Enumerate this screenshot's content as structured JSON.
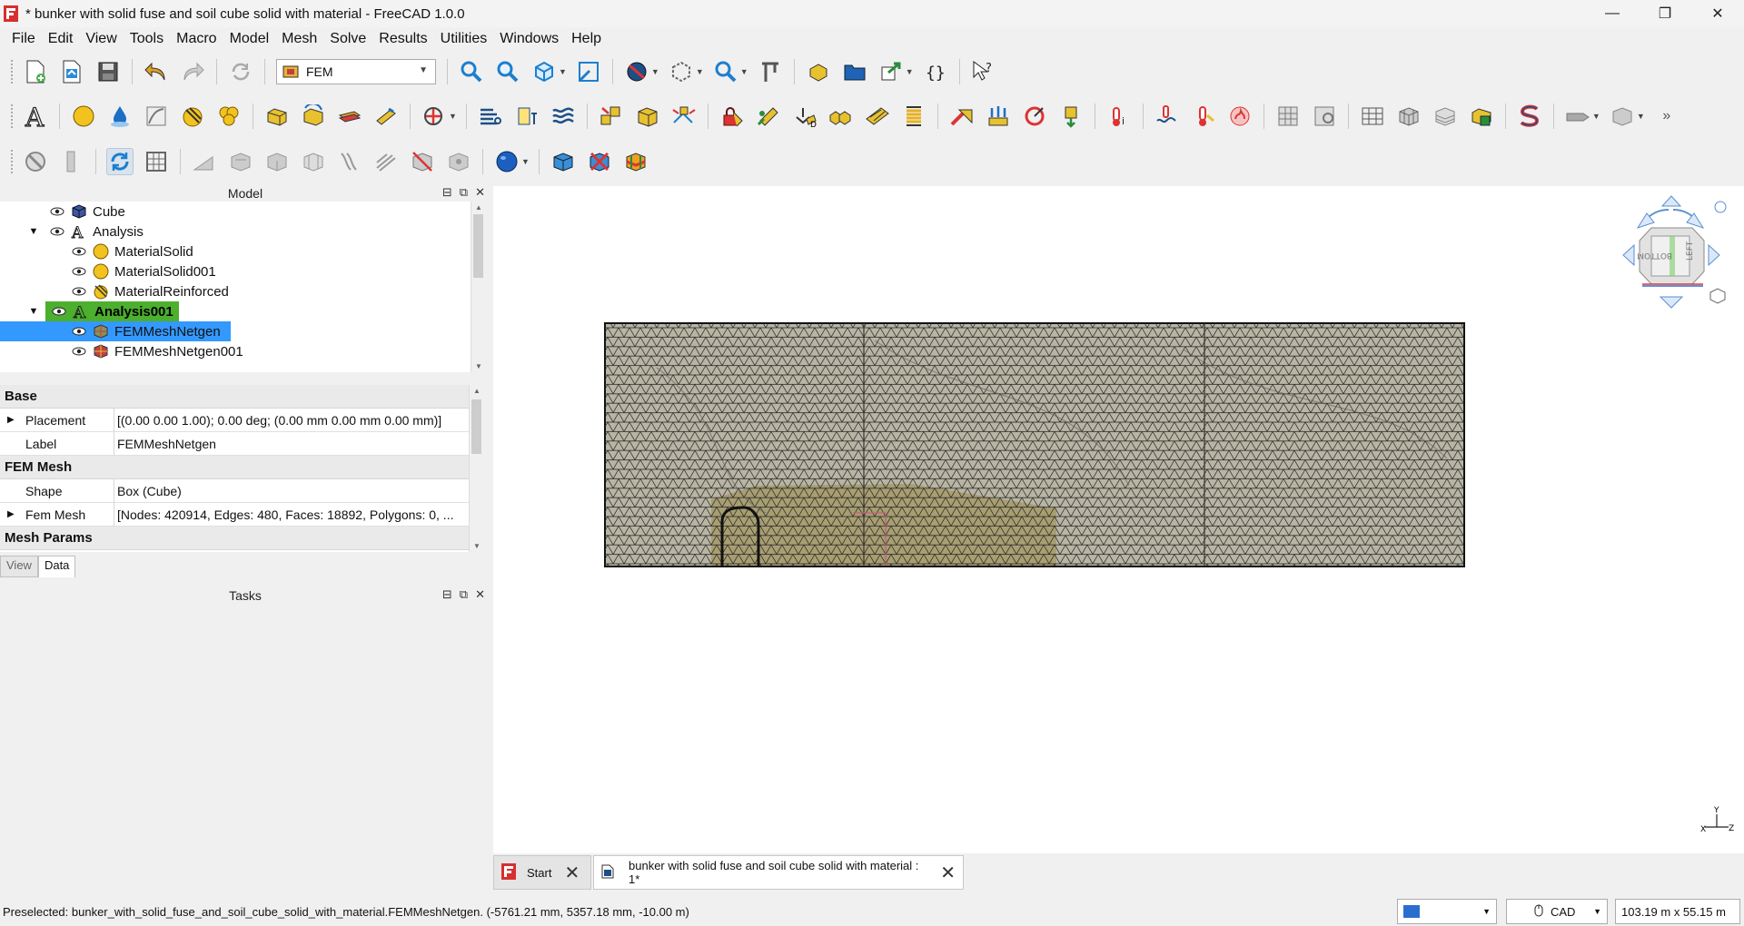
{
  "window": {
    "title": "* bunker with solid fuse and soil cube solid with material - FreeCAD 1.0.0",
    "minimize": "—",
    "maximize": "❐",
    "close": "✕"
  },
  "menu": [
    "File",
    "Edit",
    "View",
    "Tools",
    "Macro",
    "Model",
    "Mesh",
    "Solve",
    "Results",
    "Utilities",
    "Windows",
    "Help"
  ],
  "workbench": {
    "selected": "FEM"
  },
  "model_panel": {
    "title": "Model",
    "tree": [
      {
        "label": "Cube",
        "icon": "cube-icon"
      },
      {
        "label": "Analysis",
        "icon": "analysis-icon"
      },
      {
        "label": "MaterialSolid",
        "icon": "material-solid-icon"
      },
      {
        "label": "MaterialSolid001",
        "icon": "material-solid-icon"
      },
      {
        "label": "MaterialReinforced",
        "icon": "material-reinforced-icon"
      },
      {
        "label": "Analysis001",
        "icon": "analysis-icon"
      },
      {
        "label": "FEMMeshNetgen",
        "icon": "fem-mesh-icon"
      },
      {
        "label": "FEMMeshNetgen001",
        "icon": "fem-mesh-icon"
      }
    ]
  },
  "properties": {
    "groups": [
      {
        "name": "Base"
      },
      {
        "name": "FEM Mesh"
      },
      {
        "name": "Mesh Params"
      }
    ],
    "rows": [
      {
        "name": "Placement",
        "value": "[(0.00 0.00 1.00); 0.00 deg; (0.00 mm  0.00 mm  0.00 mm)]"
      },
      {
        "name": "Label",
        "value": "FEMMeshNetgen"
      },
      {
        "name": "Shape",
        "value": "Box (Cube)"
      },
      {
        "name": "Fem Mesh",
        "value": "[Nodes: 420914, Edges: 480, Faces: 18892, Polygons: 0, ..."
      }
    ],
    "tabs": [
      "View",
      "Data"
    ]
  },
  "tasks_panel": {
    "title": "Tasks"
  },
  "navcube": {
    "face_left": "LEFT",
    "face_bottom": "BOTTOM"
  },
  "axis": {
    "y": "Y",
    "x": "X",
    "z": "Z"
  },
  "doc_tabs": [
    {
      "label": "Start"
    },
    {
      "label": "bunker with solid fuse and soil cube solid with material : 1*"
    }
  ],
  "status": {
    "text": "Preselected: bunker_with_solid_fuse_and_soil_cube_solid_with_material.FEMMeshNetgen. (-5761.21 mm, 5357.18 mm, -10.00 m)",
    "nav_style": "CAD",
    "dimensions": "103.19 m x 55.15 m"
  },
  "colors": {
    "accent": "#3399ff",
    "highlight_green": "#4caf2e",
    "mesh_fill": "#b9b5a4",
    "bunker_fill": "#a49a6a"
  }
}
